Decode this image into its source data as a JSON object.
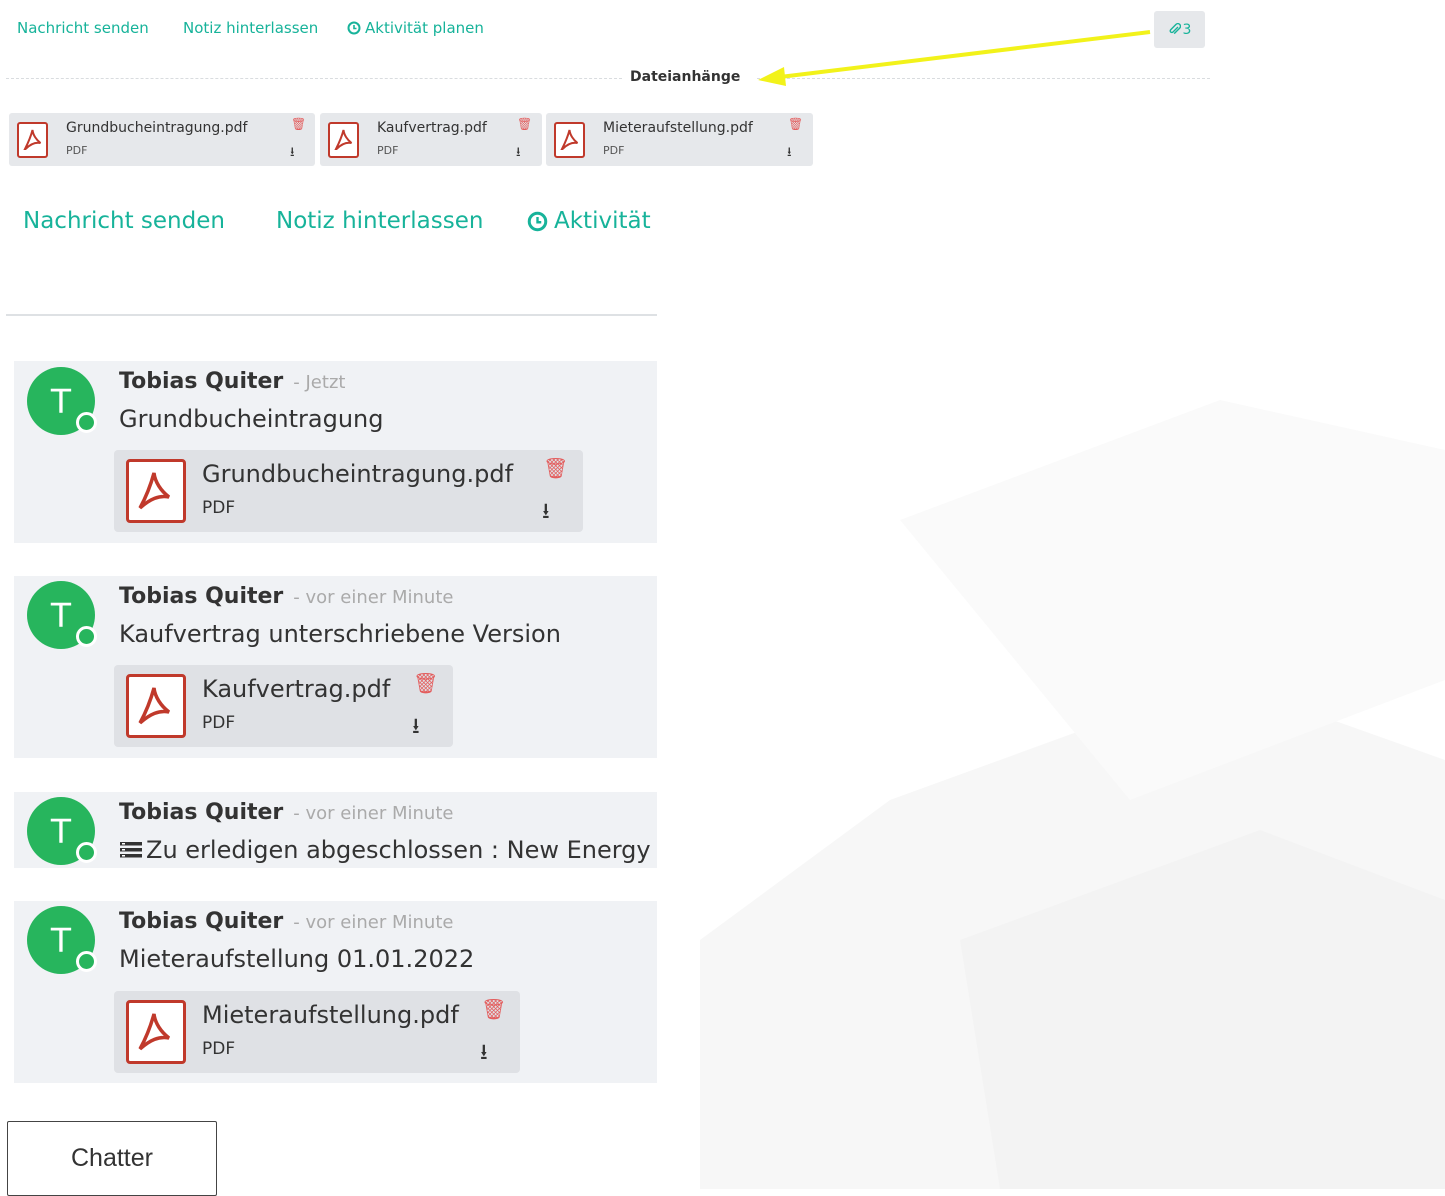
{
  "chatter_top": {
    "send_message": "Nachricht senden",
    "log_note": "Notiz hinterlassen",
    "schedule_activity": "Aktivität planen",
    "attachment_count": "3",
    "attachments_label": "Dateianhänge",
    "attachments": [
      {
        "name": "Grundbucheintragung.pdf",
        "type": "PDF"
      },
      {
        "name": "Kaufvertrag.pdf",
        "type": "PDF"
      },
      {
        "name": "Mieteraufstellung.pdf",
        "type": "PDF"
      }
    ]
  },
  "chatter_zoom": {
    "send_message": "Nachricht senden",
    "log_note": "Notiz hinterlassen",
    "activity": "Aktivität"
  },
  "messages": [
    {
      "avatar": "T",
      "author": "Tobias Quiter",
      "time": "- Jetzt",
      "body": "Grundbucheintragung",
      "attachment": {
        "name": "Grundbucheintragung.pdf",
        "type": "PDF"
      }
    },
    {
      "avatar": "T",
      "author": "Tobias Quiter",
      "time": "- vor einer Minute",
      "body": "Kaufvertrag unterschriebene Version",
      "attachment": {
        "name": "Kaufvertrag.pdf",
        "type": "PDF"
      }
    },
    {
      "avatar": "T",
      "author": "Tobias Quiter",
      "time": "- vor einer Minute",
      "body": "Zu erledigen abgeschlossen : New Energy"
    },
    {
      "avatar": "T",
      "author": "Tobias Quiter",
      "time": "- vor einer Minute",
      "body": "Mieteraufstellung 01.01.2022",
      "attachment": {
        "name": "Mieteraufstellung.pdf",
        "type": "PDF"
      }
    }
  ],
  "footer_tab": "Chatter",
  "colors": {
    "accent": "#17b39a",
    "avatar": "#27b55d",
    "pdf_red": "#c0392b",
    "delete_red": "#e35d5d",
    "annotation_arrow": "#f2f21a"
  },
  "icons": {
    "paperclip": "paperclip-icon",
    "clock": "clock-icon",
    "pdf": "pdf-file-icon",
    "trash": "trash-icon",
    "download": "download-icon",
    "todo": "todo-list-icon"
  }
}
